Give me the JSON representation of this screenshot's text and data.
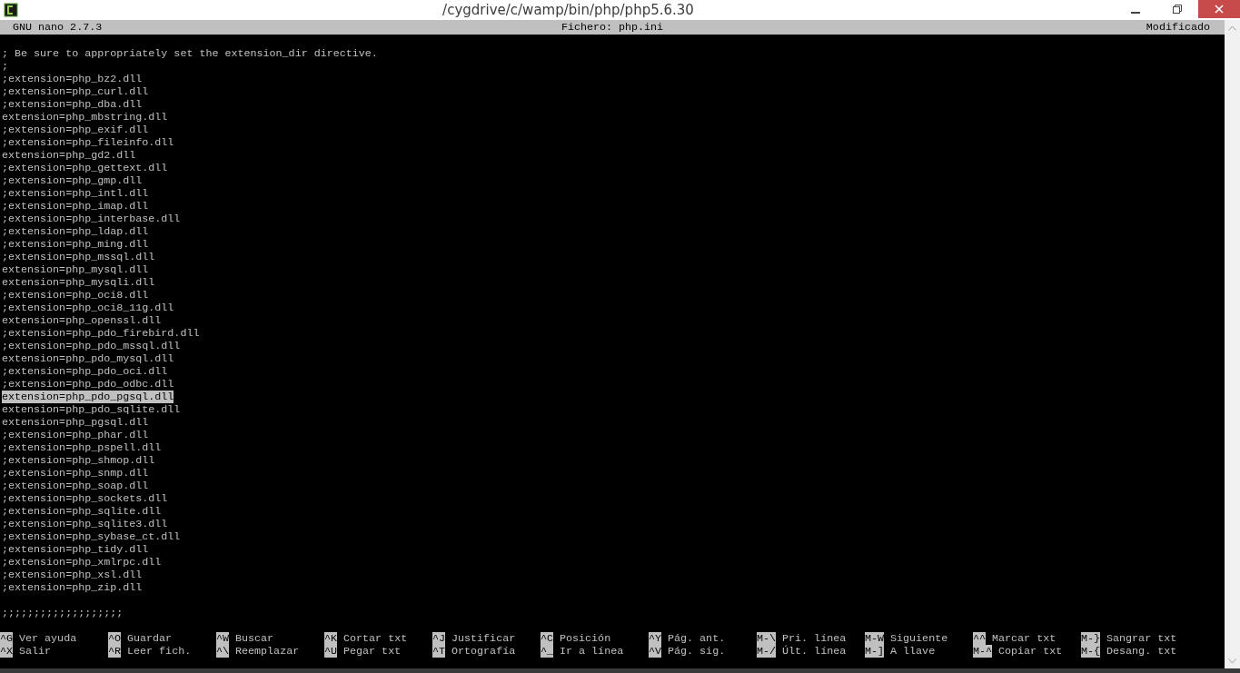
{
  "window": {
    "title": "/cygdrive/c/wamp/bin/php/php5.6.30"
  },
  "header": {
    "version": "GNU nano 2.7.3",
    "file": "Fichero: php.ini",
    "status": "Modificado"
  },
  "lines": [
    {
      "kind": "blank",
      "selected": false
    },
    {
      "kind": "text",
      "text": "; Be sure to appropriately set the extension_dir directive.",
      "selected": false
    },
    {
      "kind": "text",
      "text": ";",
      "selected": false
    },
    {
      "kind": "text",
      "text": ";extension=php_bz2.dll",
      "selected": false
    },
    {
      "kind": "text",
      "text": ";extension=php_curl.dll",
      "selected": false
    },
    {
      "kind": "text",
      "text": ";extension=php_dba.dll",
      "selected": false
    },
    {
      "kind": "text",
      "text": "extension=php_mbstring.dll",
      "selected": false
    },
    {
      "kind": "text",
      "text": ";extension=php_exif.dll",
      "selected": false
    },
    {
      "kind": "text",
      "text": ";extension=php_fileinfo.dll",
      "selected": false
    },
    {
      "kind": "text",
      "text": "extension=php_gd2.dll",
      "selected": false
    },
    {
      "kind": "text",
      "text": ";extension=php_gettext.dll",
      "selected": false
    },
    {
      "kind": "text",
      "text": ";extension=php_gmp.dll",
      "selected": false
    },
    {
      "kind": "text",
      "text": ";extension=php_intl.dll",
      "selected": false
    },
    {
      "kind": "text",
      "text": ";extension=php_imap.dll",
      "selected": false
    },
    {
      "kind": "text",
      "text": ";extension=php_interbase.dll",
      "selected": false
    },
    {
      "kind": "text",
      "text": ";extension=php_ldap.dll",
      "selected": false
    },
    {
      "kind": "text",
      "text": ";extension=php_ming.dll",
      "selected": false
    },
    {
      "kind": "text",
      "text": ";extension=php_mssql.dll",
      "selected": false
    },
    {
      "kind": "text",
      "text": "extension=php_mysql.dll",
      "selected": false
    },
    {
      "kind": "text",
      "text": "extension=php_mysqli.dll",
      "selected": false
    },
    {
      "kind": "text",
      "text": ";extension=php_oci8.dll",
      "selected": false
    },
    {
      "kind": "text",
      "text": ";extension=php_oci8_11g.dll",
      "selected": false
    },
    {
      "kind": "text",
      "text": "extension=php_openssl.dll",
      "selected": false
    },
    {
      "kind": "text",
      "text": ";extension=php_pdo_firebird.dll",
      "selected": false
    },
    {
      "kind": "text",
      "text": ";extension=php_pdo_mssql.dll",
      "selected": false
    },
    {
      "kind": "text",
      "text": "extension=php_pdo_mysql.dll",
      "selected": false
    },
    {
      "kind": "text",
      "text": ";extension=php_pdo_oci.dll",
      "selected": false
    },
    {
      "kind": "text",
      "text": ";extension=php_pdo_odbc.dll",
      "selected": false
    },
    {
      "kind": "text",
      "text": "extension=php_pdo_pgsql.dll",
      "selected": true
    },
    {
      "kind": "text",
      "text": "extension=php_pdo_sqlite.dll",
      "selected": false
    },
    {
      "kind": "text",
      "text": "extension=php_pgsql.dll",
      "selected": false
    },
    {
      "kind": "text",
      "text": ";extension=php_phar.dll",
      "selected": false
    },
    {
      "kind": "text",
      "text": ";extension=php_pspell.dll",
      "selected": false
    },
    {
      "kind": "text",
      "text": ";extension=php_shmop.dll",
      "selected": false
    },
    {
      "kind": "text",
      "text": ";extension=php_snmp.dll",
      "selected": false
    },
    {
      "kind": "text",
      "text": ";extension=php_soap.dll",
      "selected": false
    },
    {
      "kind": "text",
      "text": ";extension=php_sockets.dll",
      "selected": false
    },
    {
      "kind": "text",
      "text": ";extension=php_sqlite.dll",
      "selected": false
    },
    {
      "kind": "text",
      "text": ";extension=php_sqlite3.dll",
      "selected": false
    },
    {
      "kind": "text",
      "text": ";extension=php_sybase_ct.dll",
      "selected": false
    },
    {
      "kind": "text",
      "text": ";extension=php_tidy.dll",
      "selected": false
    },
    {
      "kind": "text",
      "text": ";extension=php_xmlrpc.dll",
      "selected": false
    },
    {
      "kind": "text",
      "text": ";extension=php_xsl.dll",
      "selected": false
    },
    {
      "kind": "text",
      "text": ";extension=php_zip.dll",
      "selected": false
    },
    {
      "kind": "blank",
      "selected": false
    },
    {
      "kind": "text",
      "text": ";;;;;;;;;;;;;;;;;;;",
      "selected": false
    },
    {
      "kind": "blank",
      "selected": false
    }
  ],
  "shortcuts": [
    [
      {
        "key": "^G",
        "label": "Ver ayuda"
      },
      {
        "key": "^O",
        "label": "Guardar"
      },
      {
        "key": "^W",
        "label": "Buscar"
      },
      {
        "key": "^K",
        "label": "Cortar txt"
      },
      {
        "key": "^J",
        "label": "Justificar"
      },
      {
        "key": "^C",
        "label": "Posición"
      },
      {
        "key": "^Y",
        "label": "Pág. ant."
      },
      {
        "key": "M-\\",
        "label": "Pri. línea"
      },
      {
        "key": "M-W",
        "label": "Siguiente"
      },
      {
        "key": "^^",
        "label": "Marcar txt"
      },
      {
        "key": "M-}",
        "label": "Sangrar txt"
      }
    ],
    [
      {
        "key": "^X",
        "label": "Salir"
      },
      {
        "key": "^R",
        "label": "Leer fich."
      },
      {
        "key": "^\\",
        "label": "Reemplazar"
      },
      {
        "key": "^U",
        "label": "Pegar txt"
      },
      {
        "key": "^T",
        "label": "Ortografía"
      },
      {
        "key": "^_",
        "label": "Ir a línea"
      },
      {
        "key": "^V",
        "label": "Pág. sig."
      },
      {
        "key": "M-/",
        "label": "Últ. línea"
      },
      {
        "key": "M-]",
        "label": "A llave"
      },
      {
        "key": "M-^",
        "label": "Copiar txt"
      },
      {
        "key": "M-{",
        "label": "Desang. txt"
      }
    ]
  ]
}
